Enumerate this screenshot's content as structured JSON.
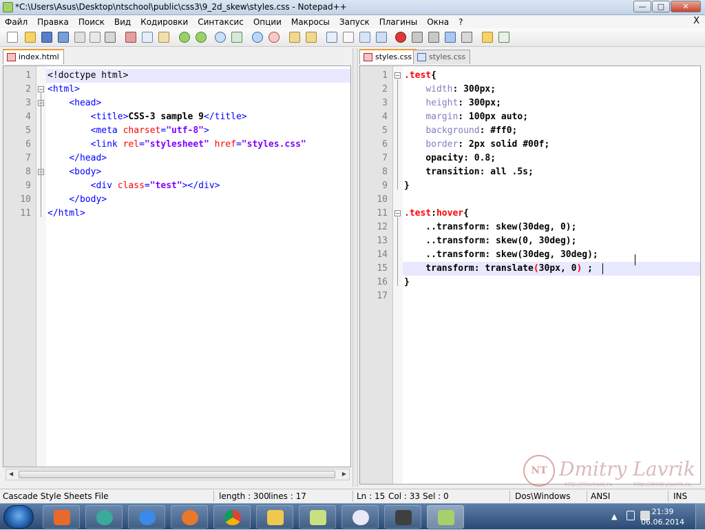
{
  "window": {
    "title": "*C:\\Users\\Asus\\Desktop\\ntschool\\public\\css3\\9_2d_skew\\styles.css - Notepad++",
    "controls": {
      "minimize": "—",
      "maximize": "□",
      "close": "✕"
    }
  },
  "menubar": {
    "items": [
      "Файл",
      "Правка",
      "Поиск",
      "Вид",
      "Кодировки",
      "Синтаксис",
      "Опции",
      "Макросы",
      "Запуск",
      "Плагины",
      "Окна",
      "?"
    ],
    "close": "X"
  },
  "toolbar": {
    "icons": [
      "new-file-icon",
      "open-file-icon",
      "save-icon",
      "save-all-icon",
      "close-icon",
      "close-all-icon",
      "print-icon",
      "cut-icon",
      "copy-icon",
      "paste-icon",
      "undo-icon",
      "redo-icon",
      "find-icon",
      "replace-icon",
      "zoom-in-icon",
      "zoom-out-icon",
      "sync-v-icon",
      "sync-h-icon",
      "wrap-icon",
      "all-chars-icon",
      "indent-guide-icon",
      "doc-map-icon",
      "record-icon",
      "stop-icon",
      "play-icon",
      "play-multi-icon",
      "save-macro-icon",
      "folder-icon",
      "spellcheck-icon"
    ]
  },
  "left_pane": {
    "tabs": [
      {
        "label": "index.html",
        "active": true
      }
    ],
    "lines": [
      {
        "n": "1",
        "segs": [
          [
            "t-doc",
            "<!doctype html>"
          ]
        ]
      },
      {
        "n": "2",
        "segs": [
          [
            "t-tag",
            "<html>"
          ]
        ]
      },
      {
        "n": "3",
        "segs": [
          [
            "t-doc",
            "    "
          ],
          [
            "t-tag",
            "<head>"
          ]
        ]
      },
      {
        "n": "4",
        "segs": [
          [
            "t-doc",
            "        "
          ],
          [
            "t-tag",
            "<title>"
          ],
          [
            "t-txt",
            "CSS-3 sample 9"
          ],
          [
            "t-tag",
            "</title>"
          ]
        ]
      },
      {
        "n": "5",
        "segs": [
          [
            "t-doc",
            "        "
          ],
          [
            "t-tag",
            "<meta "
          ],
          [
            "t-attr",
            "charset"
          ],
          [
            "t-tag",
            "="
          ],
          [
            "t-str",
            "\"utf-8\""
          ],
          [
            "t-tag",
            ">"
          ]
        ]
      },
      {
        "n": "6",
        "segs": [
          [
            "t-doc",
            "        "
          ],
          [
            "t-tag",
            "<link "
          ],
          [
            "t-attr",
            "rel"
          ],
          [
            "t-tag",
            "="
          ],
          [
            "t-str",
            "\"stylesheet\""
          ],
          [
            "t-tag",
            " "
          ],
          [
            "t-attr",
            "href"
          ],
          [
            "t-tag",
            "="
          ],
          [
            "t-str",
            "\"styles.css\""
          ]
        ]
      },
      {
        "n": "7",
        "segs": [
          [
            "t-doc",
            "    "
          ],
          [
            "t-tag",
            "</head>"
          ]
        ]
      },
      {
        "n": "8",
        "segs": [
          [
            "t-doc",
            "    "
          ],
          [
            "t-tag",
            "<body>"
          ]
        ]
      },
      {
        "n": "9",
        "segs": [
          [
            "t-doc",
            "        "
          ],
          [
            "t-tag",
            "<div "
          ],
          [
            "t-attr",
            "class"
          ],
          [
            "t-tag",
            "="
          ],
          [
            "t-str",
            "\"test\""
          ],
          [
            "t-tag",
            "></div>"
          ]
        ]
      },
      {
        "n": "10",
        "segs": [
          [
            "t-doc",
            "    "
          ],
          [
            "t-tag",
            "</body>"
          ]
        ]
      },
      {
        "n": "11",
        "segs": [
          [
            "t-tag",
            "</html>"
          ]
        ]
      }
    ]
  },
  "right_pane": {
    "tabs": [
      {
        "label": "styles.css",
        "active": true
      },
      {
        "label": "styles.css",
        "active": false
      }
    ],
    "lines": [
      {
        "n": "1",
        "segs": [
          [
            "c-sel",
            ".test"
          ],
          [
            "c-brace",
            "{"
          ]
        ]
      },
      {
        "n": "2",
        "segs": [
          [
            "c-val",
            "    "
          ],
          [
            "c-prop",
            "width"
          ],
          [
            "c-val",
            ": 300px;"
          ]
        ]
      },
      {
        "n": "3",
        "segs": [
          [
            "c-val",
            "    "
          ],
          [
            "c-prop",
            "height"
          ],
          [
            "c-val",
            ": 300px;"
          ]
        ]
      },
      {
        "n": "4",
        "segs": [
          [
            "c-val",
            "    "
          ],
          [
            "c-prop",
            "margin"
          ],
          [
            "c-val",
            ": 100px auto;"
          ]
        ]
      },
      {
        "n": "5",
        "segs": [
          [
            "c-val",
            "    "
          ],
          [
            "c-prop",
            "background"
          ],
          [
            "c-val",
            ": #ff0;"
          ]
        ]
      },
      {
        "n": "6",
        "segs": [
          [
            "c-val",
            "    "
          ],
          [
            "c-prop",
            "border"
          ],
          [
            "c-val",
            ": 2px solid #00f;"
          ]
        ]
      },
      {
        "n": "7",
        "segs": [
          [
            "c-val",
            "    opacity: 0.8;"
          ]
        ]
      },
      {
        "n": "8",
        "segs": [
          [
            "c-val",
            "    transition: all .5s;"
          ]
        ]
      },
      {
        "n": "9",
        "segs": [
          [
            "c-brace",
            "}"
          ]
        ]
      },
      {
        "n": "10",
        "segs": []
      },
      {
        "n": "11",
        "segs": [
          [
            "c-sel",
            ".test"
          ],
          [
            "c-val",
            ":"
          ],
          [
            "c-sel",
            "hover"
          ],
          [
            "c-brace",
            "{"
          ]
        ]
      },
      {
        "n": "12",
        "segs": [
          [
            "c-val",
            "    ..transform: skew(30deg, 0);"
          ]
        ]
      },
      {
        "n": "13",
        "segs": [
          [
            "c-val",
            "    ..transform: skew(0, 30deg);"
          ]
        ]
      },
      {
        "n": "14",
        "segs": [
          [
            "c-val",
            "    ..transform: skew(30deg, 30deg);"
          ]
        ]
      },
      {
        "n": "15",
        "segs": [
          [
            "c-val",
            "    transform: translate"
          ],
          [
            "c-sel",
            "("
          ],
          [
            "c-val",
            "30px, 0"
          ],
          [
            "c-sel",
            ")"
          ],
          [
            "c-val",
            " ;"
          ]
        ]
      },
      {
        "n": "16",
        "segs": [
          [
            "c-brace",
            "}"
          ]
        ]
      },
      {
        "n": "17",
        "segs": []
      }
    ]
  },
  "statusbar": {
    "file_type": "Cascade Style Sheets File",
    "length": "length : 300",
    "lines": "lines : 17",
    "ln": "Ln : 15",
    "col": "Col : 33",
    "sel": "Sel : 0",
    "eol": "Dos\\Windows",
    "encoding": "ANSI",
    "mode": "INS"
  },
  "watermark": {
    "seal": "NT",
    "name": "Dmitry Lavrik",
    "url1": "http://ntschool.ru",
    "url2": "http://dmitrylavrik.ru"
  },
  "taskbar": {
    "apps": [
      "start-button",
      "office-icon",
      "qip-icon",
      "ie-icon",
      "firefox-icon",
      "chrome-icon",
      "explorer-icon",
      "sticky-notes-icon",
      "paint-icon",
      "camtasia-icon",
      "notepadpp-icon"
    ],
    "clock_time": "21:39",
    "clock_date": "06.06.2014"
  },
  "colors": {
    "accent_tab": "#f29a2e",
    "current_line": "#e8e8ff",
    "selector": "#ff0000",
    "property": "#8080c0",
    "tag": "#0000ff",
    "string": "#8000ff"
  }
}
